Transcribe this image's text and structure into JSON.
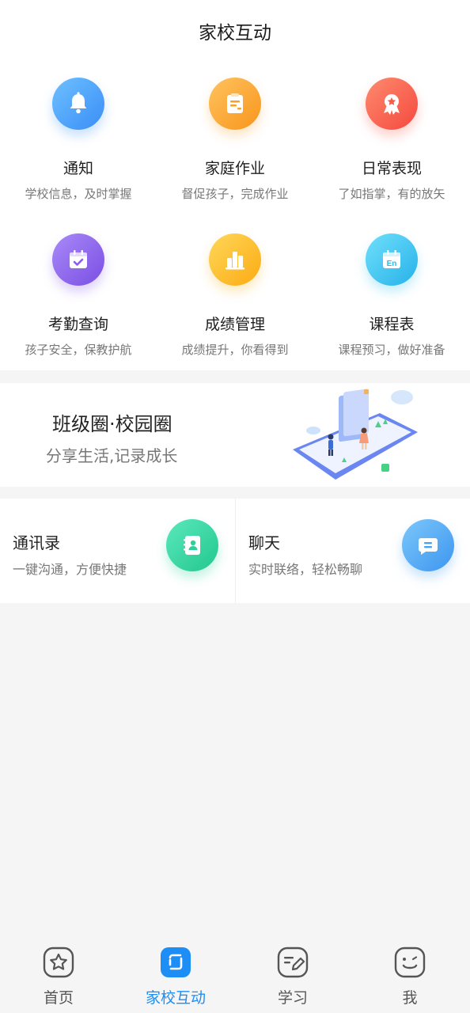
{
  "header": {
    "title": "家校互动"
  },
  "grid": [
    {
      "title": "通知",
      "subtitle": "学校信息，及时掌握",
      "icon": "bell-icon",
      "color": "#4a9df8"
    },
    {
      "title": "家庭作业",
      "subtitle": "督促孩子，完成作业",
      "icon": "clipboard-icon",
      "color": "#fba83c"
    },
    {
      "title": "日常表现",
      "subtitle": "了如指掌，有的放矢",
      "icon": "award-icon",
      "color": "#f76252"
    },
    {
      "title": "考勤查询",
      "subtitle": "孩子安全，保教护航",
      "icon": "calendar-check-icon",
      "color": "#8c62ea"
    },
    {
      "title": "成绩管理",
      "subtitle": "成绩提升，你看得到",
      "icon": "bar-chart-icon",
      "color": "#fdbb2a"
    },
    {
      "title": "课程表",
      "subtitle": "课程预习，做好准备",
      "icon": "calendar-en-icon",
      "color": "#3fc6ef"
    }
  ],
  "banner": {
    "title": "班级圈·校园圈",
    "subtitle": "分享生活,记录成长",
    "illustration": "phone-illustration"
  },
  "contacts": [
    {
      "title": "通讯录",
      "subtitle": "一键沟通，方便快捷",
      "icon": "address-book-icon",
      "color": "#32d7a0"
    },
    {
      "title": "聊天",
      "subtitle": "实时联络，轻松畅聊",
      "icon": "chat-bubble-icon",
      "color": "#4ba6f4"
    }
  ],
  "tabbar": {
    "active_color": "#1d8ef5",
    "items": [
      {
        "label": "首页",
        "icon": "home-star-icon"
      },
      {
        "label": "家校互动",
        "icon": "square-frame-icon",
        "active": true
      },
      {
        "label": "学习",
        "icon": "pen-note-icon"
      },
      {
        "label": "我",
        "icon": "smiley-icon"
      }
    ]
  }
}
